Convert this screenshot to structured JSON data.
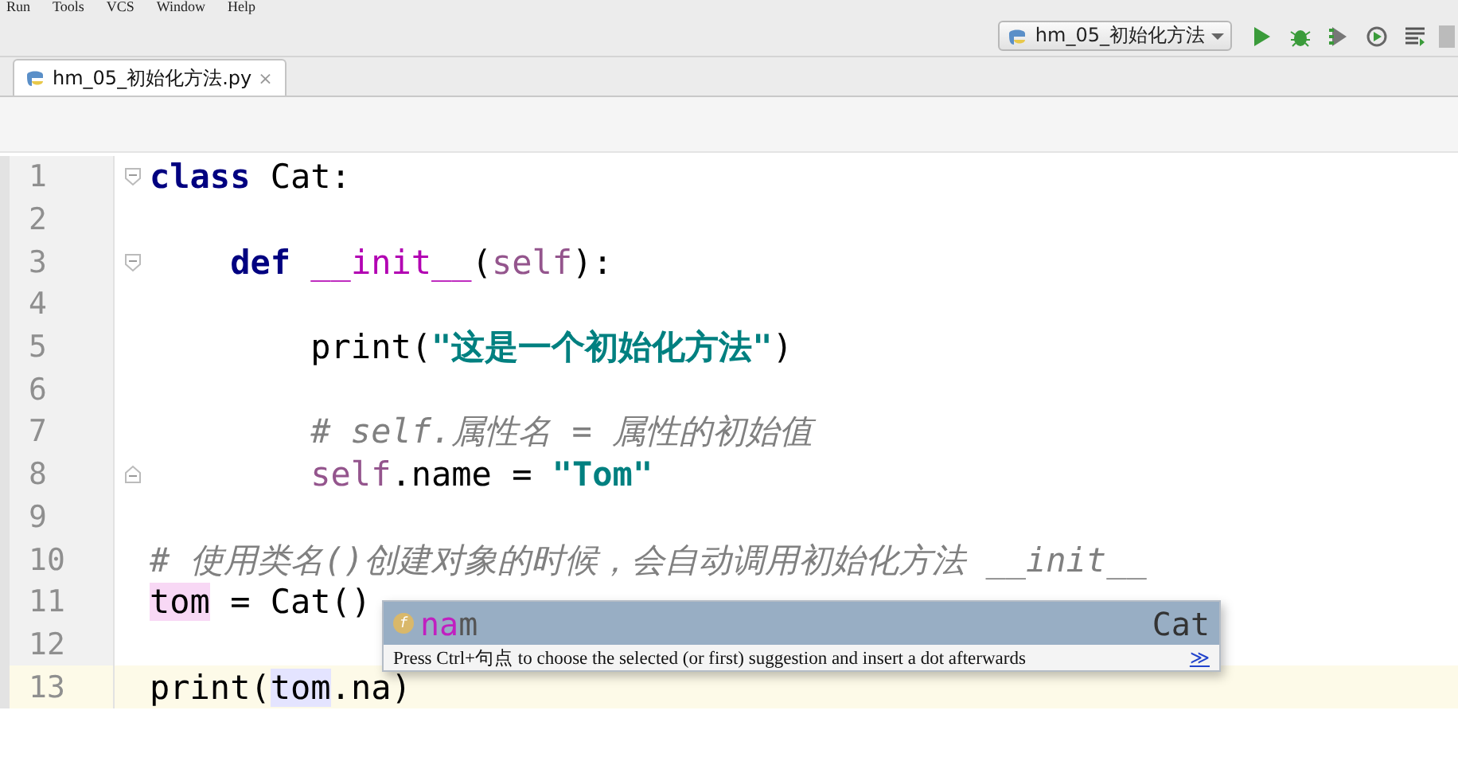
{
  "menu": [
    "Run",
    "Tools",
    "VCS",
    "Window",
    "Help"
  ],
  "run_config": {
    "label": "hm_05_初始化方法"
  },
  "tabs": [
    {
      "label": "hm_05_初始化方法.py",
      "close": "×",
      "selected": true
    }
  ],
  "lines": [
    {
      "number": "1",
      "fold_start": true,
      "fold_end": false,
      "current": false,
      "tokens": [
        {
          "text": "class",
          "kind": "keyword"
        },
        {
          "text": " Cat:",
          "kind": "plain"
        }
      ]
    },
    {
      "number": "2",
      "fold_start": false,
      "fold_end": false,
      "current": false
    },
    {
      "number": "3",
      "fold_start": true,
      "fold_end": false,
      "current": false,
      "tokens": [
        {
          "text": "    def ",
          "kind": "keyword"
        },
        {
          "text": "__init__",
          "kind": "magic"
        },
        {
          "text": "(",
          "kind": "plain"
        },
        {
          "text": "self",
          "kind": "self"
        },
        {
          "text": "):",
          "kind": "plain"
        }
      ]
    },
    {
      "number": "4",
      "fold_start": false,
      "fold_end": false,
      "current": false
    },
    {
      "number": "5",
      "fold_start": false,
      "fold_end": false,
      "current": false,
      "tokens": [
        {
          "text": "        print(",
          "kind": "plain"
        },
        {
          "text": "\"这是一个初始化方法\"",
          "kind": "string"
        },
        {
          "text": ")",
          "kind": "plain"
        }
      ]
    },
    {
      "number": "6",
      "fold_start": false,
      "fold_end": false,
      "current": false
    },
    {
      "number": "7",
      "fold_start": false,
      "fold_end": false,
      "current": false,
      "tokens": [
        {
          "text": "        # self.属性名 = 属性的初始值",
          "kind": "comment"
        }
      ]
    },
    {
      "number": "8",
      "fold_start": false,
      "fold_end": true,
      "current": false,
      "tokens": [
        {
          "text": "        self",
          "kind": "self"
        },
        {
          "text": ".name = ",
          "kind": "plain"
        },
        {
          "text": "\"Tom\"",
          "kind": "string"
        }
      ]
    },
    {
      "number": "9",
      "fold_start": false,
      "fold_end": false,
      "current": false
    },
    {
      "number": "10",
      "fold_start": false,
      "fold_end": false,
      "current": false,
      "tokens": [
        {
          "text": "# 使用类名()创建对象的时候，会自动调用初始化方法 __init__",
          "kind": "comment"
        }
      ]
    },
    {
      "number": "11",
      "fold_start": false,
      "fold_end": false,
      "current": false,
      "tokens": [
        {
          "text": "tom",
          "kind": "write-usage"
        },
        {
          "text": " = Cat()",
          "kind": "plain"
        }
      ]
    },
    {
      "number": "12",
      "fold_start": false,
      "fold_end": false,
      "current": false
    },
    {
      "number": "13",
      "fold_start": false,
      "fold_end": false,
      "current": true,
      "tokens": [
        {
          "text": "print(",
          "kind": "plain"
        },
        {
          "text": "tom",
          "kind": "read-usage"
        },
        {
          "text": ".na)",
          "kind": "plain"
        }
      ]
    }
  ],
  "completion": {
    "item": {
      "icon": "f",
      "match": "na",
      "rest": "m",
      "type": "Cat",
      "selected": true
    },
    "hint": "Press Ctrl+句点 to choose the selected (or first) suggestion and insert a dot afterwards",
    "hint_link": "≫"
  }
}
